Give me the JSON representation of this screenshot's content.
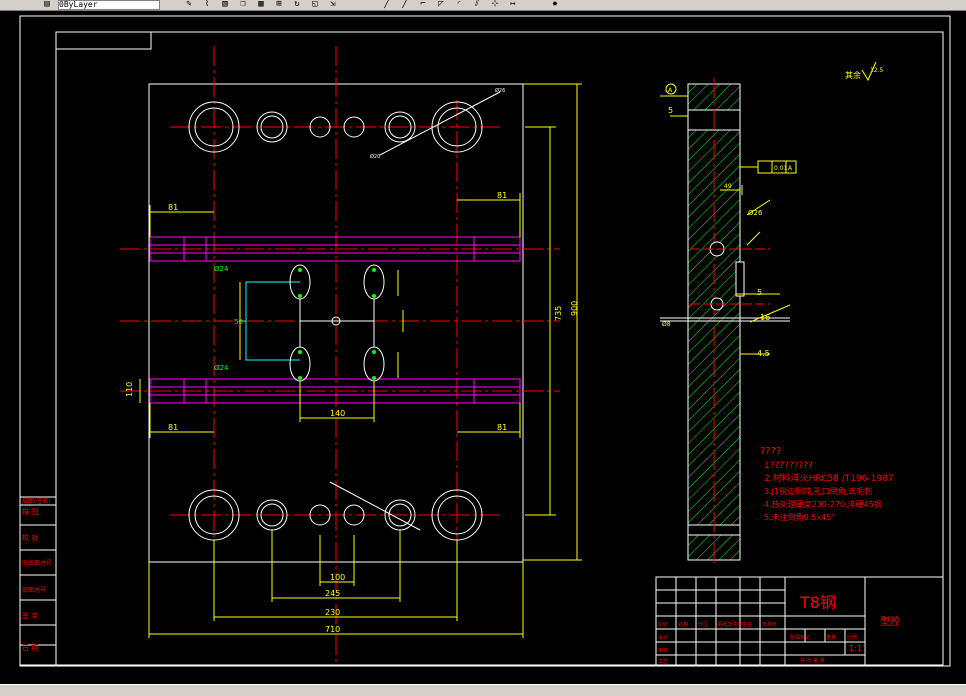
{
  "toolbar": {
    "layer_combo": "0ByLayer",
    "tools": [
      "pencil-icon",
      "brush-icon",
      "hatch-icon",
      "copy-icon",
      "array-icon",
      "move-icon",
      "rotate-icon",
      "scale-icon",
      "stretch-icon",
      "trim-icon",
      "extend-icon",
      "break-icon",
      "chamfer-icon",
      "fillet-icon",
      "explode-icon"
    ]
  },
  "colors": {
    "background": "#000000",
    "frame": "#ffffff",
    "centerline": "#ff0000",
    "dimension": "#ffff00",
    "guide_pin": "#ff00ff",
    "cooling": "#00ffff",
    "hatch": "#00ff00",
    "text_red": "#ff0000"
  },
  "dims": {
    "d81_tl": "81",
    "d81_tr": "81",
    "d81_bl": "81",
    "d81_br": "81",
    "phi24_top": "Ø24",
    "phi24_bot": "Ø24",
    "d735": "735",
    "d900": "900",
    "d140": "140",
    "d100": "100",
    "d245": "245",
    "d230": "230",
    "d710": "710",
    "d50": "50",
    "d36": "36",
    "d110": "110",
    "side_5": "5",
    "side_5b": "5",
    "side_45": "4.5",
    "side_16": "16",
    "side_49": "49",
    "side_phi26": "Ø26",
    "side_phi8": "Ø8",
    "tol": "0.01",
    "tol_ref": "A",
    "datum": "A",
    "rough": "12.5",
    "rough_label": "其余"
  },
  "notes": {
    "heading": "????",
    "lines": [
      "1?????????",
      "2.材料淬火HRC58 /T196-1987",
      "3.J1锐边倒钝,孔口倒角,去毛刺",
      "4.热处理硬度230-270,淬硬45钢",
      "5.未注倒角0.5x45°"
    ]
  },
  "title_block": {
    "material": "T8钢",
    "part_name": "型腔",
    "scale": "1:1",
    "headers": [
      "标记",
      "处数",
      "分区",
      "更改文件号",
      "签名",
      "年月日"
    ],
    "rows": [
      "设计",
      "审核",
      "工艺",
      "批准"
    ],
    "stage": "阶段标记",
    "weight": "重量",
    "ratio": "比例",
    "sheet": "共 张 第 张"
  },
  "left_panel": [
    "描图(签名)",
    "描 图",
    "校 对",
    "旧底图总号",
    "底图总号",
    "签 字",
    "日 期"
  ]
}
